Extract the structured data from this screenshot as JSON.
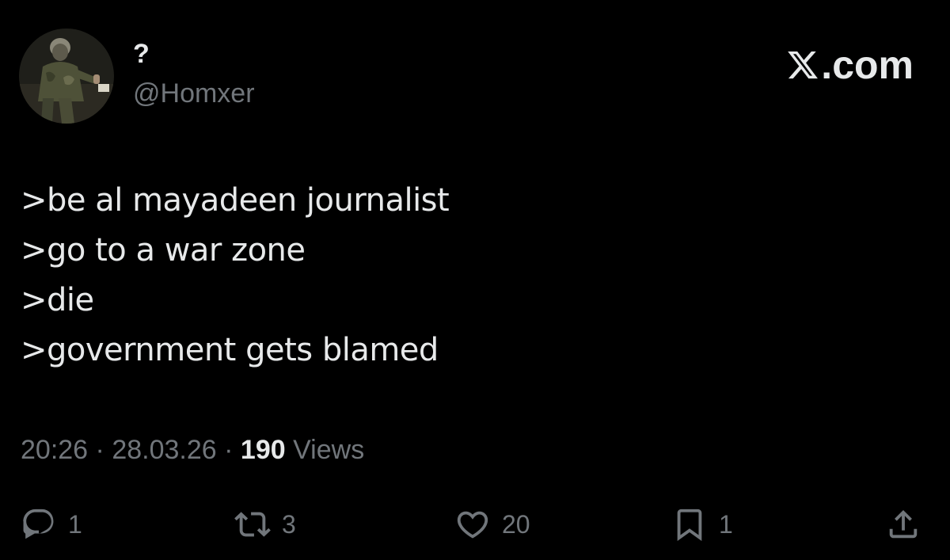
{
  "author": {
    "display_name": "?",
    "handle": "@Homxer"
  },
  "brand": {
    "label": ".com",
    "logo_icon": "x-logo-icon"
  },
  "tweet": {
    "lines": [
      ">be al mayadeen journalist",
      ">go to a war zone",
      ">die",
      ">government gets blamed"
    ]
  },
  "meta": {
    "time": "20:26",
    "separator": "·",
    "date": "28.03.26",
    "views_count": "190",
    "views_label": "Views"
  },
  "actions": {
    "reply": {
      "icon": "reply-icon",
      "count": "1"
    },
    "retweet": {
      "icon": "retweet-icon",
      "count": "3"
    },
    "like": {
      "icon": "heart-icon",
      "count": "20"
    },
    "bookmark": {
      "icon": "bookmark-icon",
      "count": "1"
    },
    "share": {
      "icon": "share-icon"
    }
  },
  "colors": {
    "background": "#000000",
    "primary_text": "#e7e9ea",
    "secondary_text": "#71767b"
  }
}
